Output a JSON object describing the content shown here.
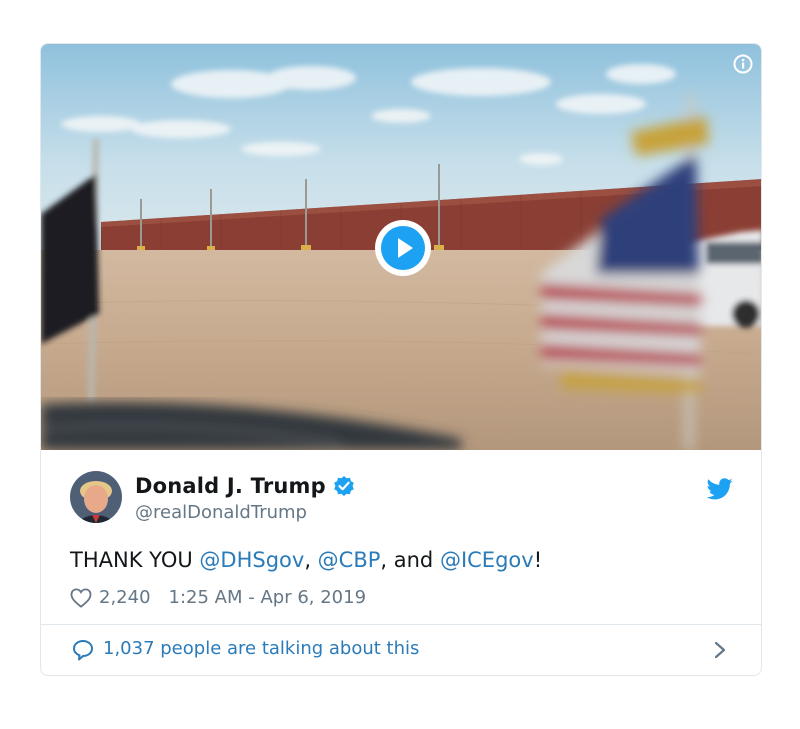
{
  "tweet": {
    "author_name": "Donald J. Trump",
    "author_handle": "@realDonaldTrump",
    "verified": true,
    "text_parts": {
      "p1": "THANK YOU ",
      "m1": "@DHSgov",
      "p2": ", ",
      "m2": "@CBP",
      "p3": ", and ",
      "m3": "@ICEgov",
      "p4": "!"
    },
    "likes": "2,240",
    "timestamp": "1:25 AM - Apr 6, 2019",
    "talking": "1,037 people are talking about this"
  },
  "icons": {
    "info": "info-icon",
    "play": "play-icon",
    "verified": "verified-badge-icon",
    "brand": "twitter-bird-icon",
    "like": "heart-icon",
    "reply": "speech-bubble-icon",
    "chevron": "chevron-right-icon"
  },
  "colors": {
    "accent": "#1da1f2",
    "link": "#2b7bb9",
    "text": "#14171a",
    "muted": "#657786",
    "border": "#e1e8ed"
  }
}
